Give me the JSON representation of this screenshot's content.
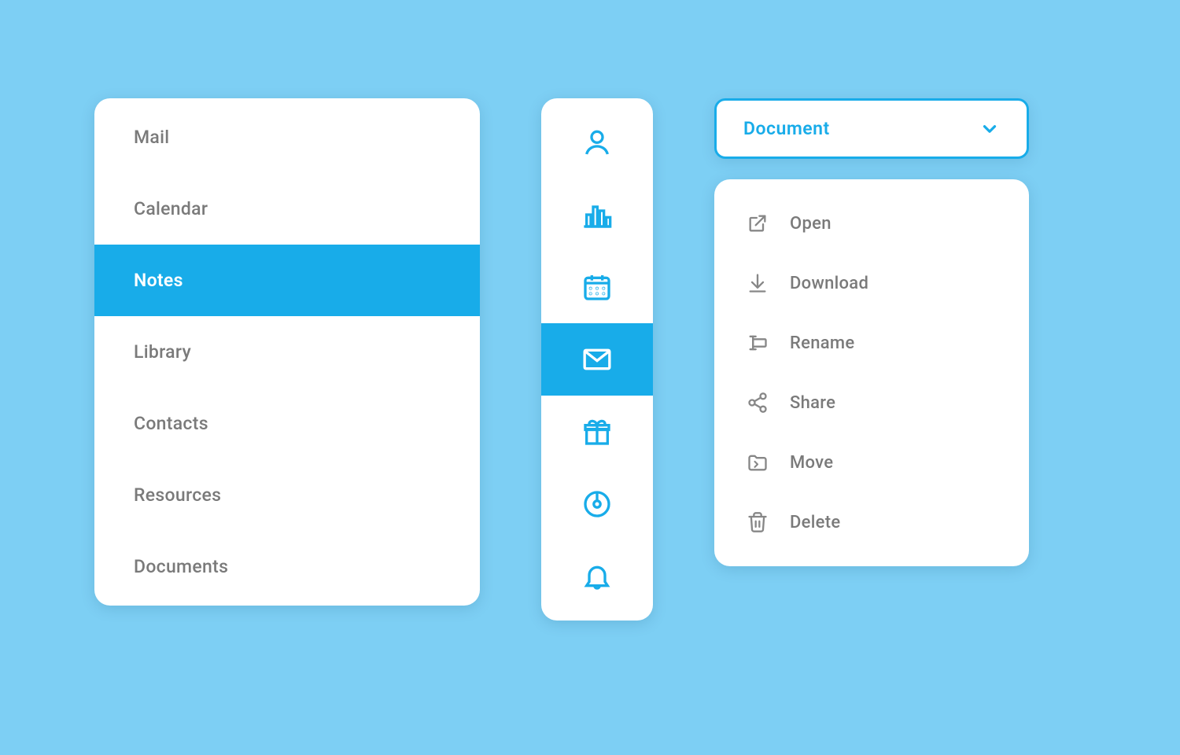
{
  "colors": {
    "accent": "#18ACE9",
    "bg": "#7DCFF4",
    "text": "#7a7a7a"
  },
  "nav": {
    "items": [
      {
        "label": "Mail",
        "selected": false
      },
      {
        "label": "Calendar",
        "selected": false
      },
      {
        "label": "Notes",
        "selected": true
      },
      {
        "label": "Library",
        "selected": false
      },
      {
        "label": "Contacts",
        "selected": false
      },
      {
        "label": "Resources",
        "selected": false
      },
      {
        "label": "Documents",
        "selected": false
      }
    ]
  },
  "icon_rail": {
    "items": [
      {
        "icon": "user-icon",
        "selected": false
      },
      {
        "icon": "bar-chart-icon",
        "selected": false
      },
      {
        "icon": "calendar-icon",
        "selected": false
      },
      {
        "icon": "mail-icon",
        "selected": true
      },
      {
        "icon": "gift-icon",
        "selected": false
      },
      {
        "icon": "disc-icon",
        "selected": false
      },
      {
        "icon": "bell-icon",
        "selected": false
      }
    ]
  },
  "dropdown": {
    "selected_label": "Document"
  },
  "menu": {
    "items": [
      {
        "label": "Open",
        "icon": "external-link-icon"
      },
      {
        "label": "Download",
        "icon": "download-icon"
      },
      {
        "label": "Rename",
        "icon": "rename-icon"
      },
      {
        "label": "Share",
        "icon": "share-icon"
      },
      {
        "label": "Move",
        "icon": "folder-move-icon"
      },
      {
        "label": "Delete",
        "icon": "trash-icon"
      }
    ]
  }
}
